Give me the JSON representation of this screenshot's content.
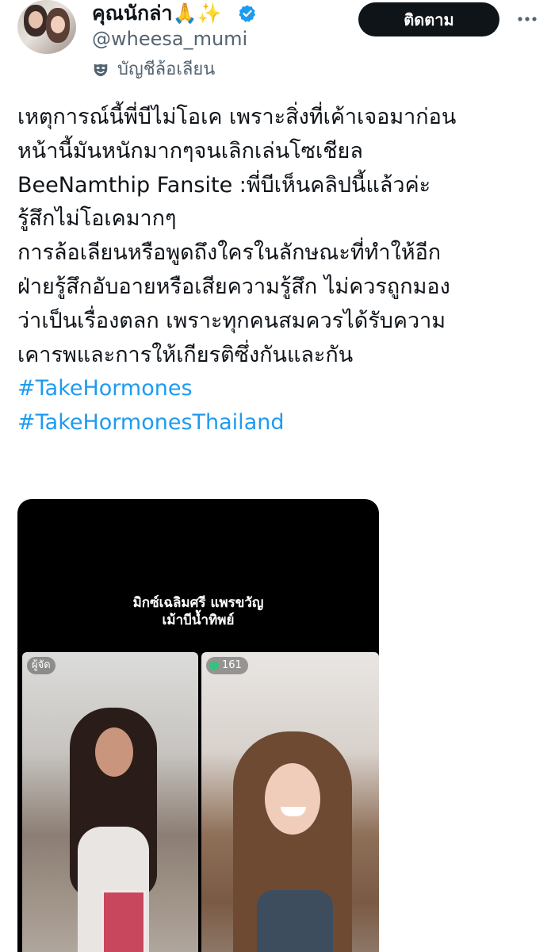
{
  "author": {
    "display_name": "คุณนักล่า",
    "name_emoji": "🙏✨",
    "handle": "@wheesa_mumi",
    "parody_label": "บัญชีล้อเลียน"
  },
  "actions": {
    "follow_label": "ติดตาม"
  },
  "tweet": {
    "lines": [
      "เหตุการณ์นี้พี่บีไม่โอเค เพราะสิ่งที่เค้าเจอมาก่อน",
      "หน้านี้มันหนักมากๆจนเลิกเล่นโซเชียล",
      "BeeNamthip Fansite :พี่บีเห็นคลิปนี้แล้วค่ะ",
      "รู้สึกไม่โอเคมากๆ",
      "การล้อเลียนหรือพูดถึงใครในลักษณะที่ทำให้อีก",
      "ฝ่ายรู้สึกอับอายหรือเสียความรู้สึก ไม่ควรถูกมอง",
      "ว่าเป็นเรื่องตลก เพราะทุกคนสมควรได้รับความ",
      "เคารพและการให้เกียรติซึ่งกันและกัน"
    ],
    "hashtags": [
      "#TakeHormones",
      "#TakeHormonesThailand"
    ]
  },
  "media": {
    "caption_line1": "มิกซ์เฉลิมศรี แพรขวัญ",
    "caption_line2": "เม้าบีน้ำทิพย์",
    "left_badge": "ผู้จัด",
    "viewer_count": "161"
  },
  "colors": {
    "text": "#0f1419",
    "secondary": "#536471",
    "link": "#1d9bf0",
    "verified": "#1d9bf0",
    "button_bg": "#0f1419"
  }
}
